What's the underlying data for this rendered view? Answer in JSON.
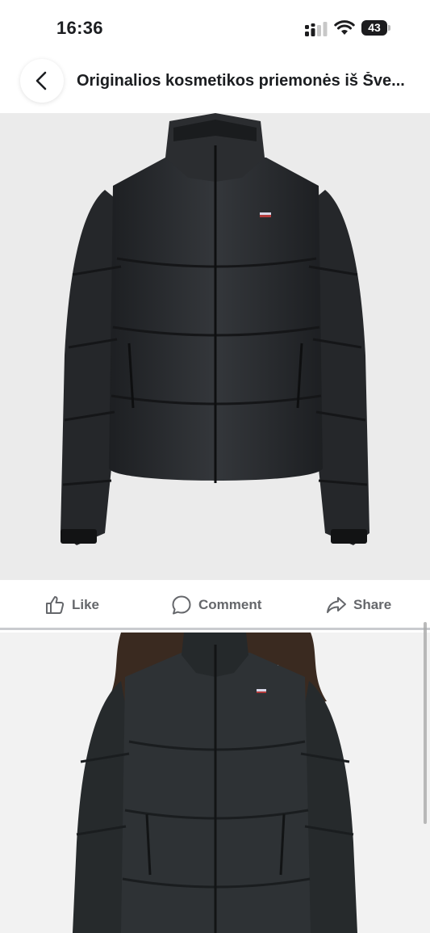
{
  "status_bar": {
    "time": "16:36",
    "battery_percent": "43",
    "icons": [
      "cellular-signal-icon",
      "wifi-icon",
      "battery-icon"
    ]
  },
  "header": {
    "back_icon": "chevron-left-icon",
    "title": "Originalios kosmetikos priemonės iš Šve..."
  },
  "photos": [
    {
      "subject": "black-puffer-jacket-product-photo"
    },
    {
      "subject": "person-wearing-black-puffer-jacket"
    }
  ],
  "actions": {
    "like_label": "Like",
    "comment_label": "Comment",
    "share_label": "Share"
  },
  "colors": {
    "action_text": "#65676b",
    "photo_background": "#ebebeb",
    "jacket": "#2a2c2f"
  }
}
